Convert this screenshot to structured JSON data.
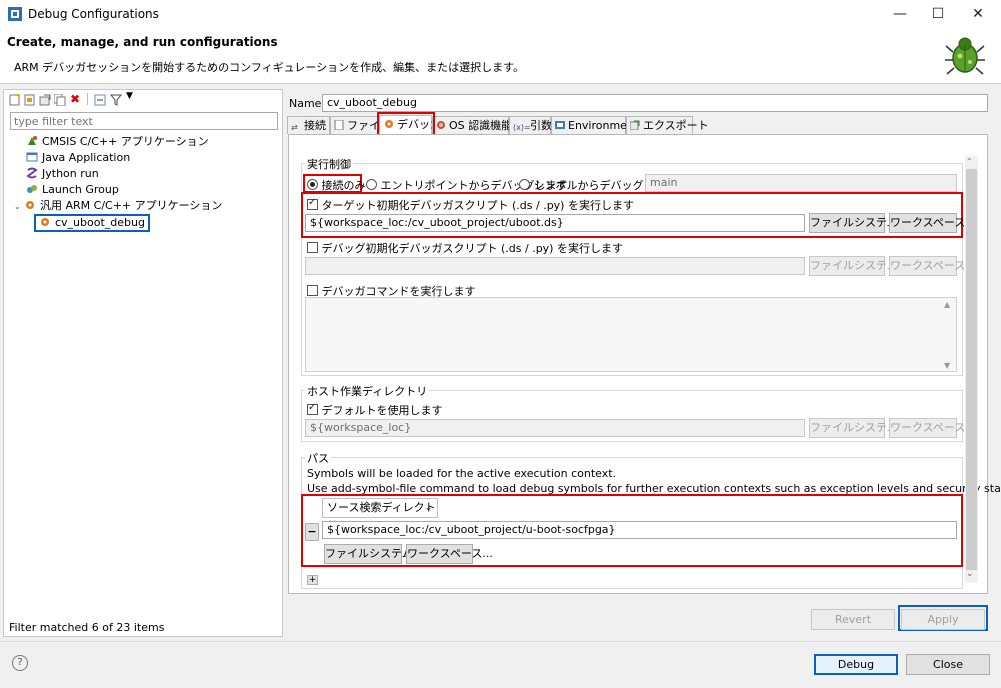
{
  "window": {
    "title": "Debug Configurations",
    "minimize": "—",
    "maximize": "☐",
    "close": "✕"
  },
  "header": {
    "title": "Create, manage, and run configurations",
    "subtitle": "ARM デバッガセッションを開始するためのコンフィギュレーションを作成、編集、または選択します。"
  },
  "left": {
    "filter_placeholder": "type filter text",
    "tree": [
      {
        "label": "CMSIS C/C++ アプリケーション",
        "icon": "cmsis-icon"
      },
      {
        "label": "Java Application",
        "icon": "java-icon"
      },
      {
        "label": "Jython run",
        "icon": "jython-icon"
      },
      {
        "label": "Launch Group",
        "icon": "launch-group-icon"
      },
      {
        "label": "汎用 ARM C/C++ アプリケーション",
        "icon": "arm-icon",
        "expanded": true
      },
      {
        "label": "cv_uboot_debug",
        "icon": "debug-config-icon",
        "selected": true
      }
    ],
    "footer": "Filter matched 6 of 23 items"
  },
  "name": {
    "label": "Name:",
    "value": "cv_uboot_debug"
  },
  "tabs": [
    "接続",
    "ファイル",
    "デバッガ",
    "OS 認識機能",
    "引数",
    "Environment",
    "エクスポート"
  ],
  "debugger": {
    "run_control_label": "実行制御",
    "radio_connect": "接続のみ",
    "radio_entry": "エントリポイントからデバッグします",
    "radio_symbol": "シンボルからデバッグします",
    "symbol_value": "main",
    "target_script_label": "ターゲット初期化デバッガスクリプト (.ds / .py) を実行します",
    "target_script_value": "${workspace_loc:/cv_uboot_project/uboot.ds}",
    "debugger_script_label": "デバッグ初期化デバッガスクリプト (.ds / .py) を実行します",
    "debugger_script_value": "",
    "debugger_cmd_label": "デバッガコマンドを実行します",
    "filesystem_btn": "ファイルシステム...",
    "workspace_btn": "ワークスペース...",
    "host_dir_label": "ホスト作業ディレクトリ",
    "use_default_label": "デフォルトを使用します",
    "host_dir_value": "${workspace_loc}",
    "paths_label": "パス",
    "paths_note1": "Symbols will be loaded for the active execution context.",
    "paths_note2": "Use add-symbol-file command to load debug symbols for further execution contexts such as exception levels and security states.",
    "source_dir_select": "ソース検索ディレクトリ",
    "source_dir_value": "${workspace_loc:/cv_uboot_project/u-boot-socfpga}",
    "minus": "−",
    "plus": "+"
  },
  "buttons": {
    "revert": "Revert",
    "apply": "Apply",
    "debug": "Debug",
    "close": "Close"
  },
  "help": "?",
  "colors": {
    "highlight_red": "#e00000",
    "highlight_blue": "#0a60c0"
  }
}
